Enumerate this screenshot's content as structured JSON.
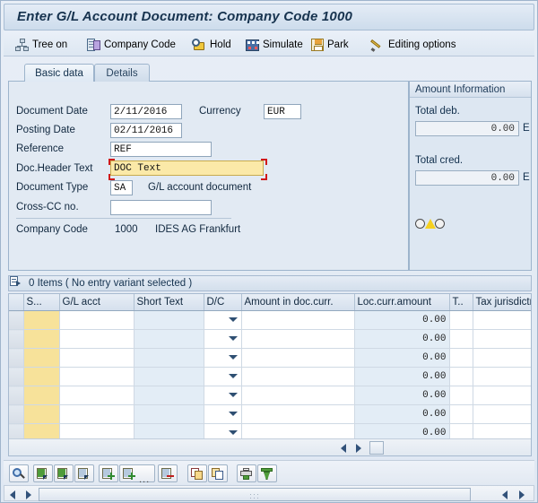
{
  "window": {
    "title": "Enter G/L Account Document: Company Code 1000"
  },
  "toolbar": {
    "items": [
      {
        "label": "Tree on",
        "icon": "tree-icon"
      },
      {
        "label": "Company Code",
        "icon": "company-code-icon"
      },
      {
        "label": "Hold",
        "icon": "hold-icon"
      },
      {
        "label": "Simulate",
        "icon": "simulate-icon"
      },
      {
        "label": "Park",
        "icon": "park-icon"
      },
      {
        "label": "Editing options",
        "icon": "pencil-icon"
      }
    ]
  },
  "tabs": [
    {
      "label": "Basic data",
      "active": true
    },
    {
      "label": "Details",
      "active": false
    }
  ],
  "basic_data": {
    "fields": [
      {
        "label": "Document Date",
        "value": "2/11/2016"
      },
      {
        "label": "Posting Date",
        "value": "02/11/2016"
      },
      {
        "label": "Reference",
        "value": "REF"
      },
      {
        "label": "Doc.Header Text",
        "value": "DOC Text"
      },
      {
        "label": "Document Type",
        "value": "SA"
      },
      {
        "label": "Cross-CC no.",
        "value": ""
      }
    ],
    "currency": {
      "label": "Currency",
      "value": "EUR"
    },
    "document_type_text": "G/L account document",
    "company_code": {
      "label": "Company Code",
      "value": "1000",
      "description": "IDES AG Frankfurt"
    }
  },
  "amount_information": {
    "header": "Amount Information",
    "total_debit": {
      "label": "Total deb.",
      "value": "0.00",
      "currency": "E"
    },
    "total_credit": {
      "label": "Total cred.",
      "value": "0.00",
      "currency": "E"
    },
    "status_indicator": "traffic-light-yellow"
  },
  "items": {
    "summary": "0 Items ( No entry variant selected )",
    "columns": [
      "S...",
      "G/L acct",
      "Short Text",
      "D/C",
      "Amount in doc.curr.",
      "Loc.curr.amount",
      "T..",
      "Tax jurisdictn code"
    ],
    "rows": [
      {
        "status": "",
        "gl_acct": "",
        "short_text": "",
        "dc": "",
        "amount_doc": "",
        "loc_amount": "0.00",
        "tax": "",
        "tax_jur": ""
      },
      {
        "status": "",
        "gl_acct": "",
        "short_text": "",
        "dc": "",
        "amount_doc": "",
        "loc_amount": "0.00",
        "tax": "",
        "tax_jur": ""
      },
      {
        "status": "",
        "gl_acct": "",
        "short_text": "",
        "dc": "",
        "amount_doc": "",
        "loc_amount": "0.00",
        "tax": "",
        "tax_jur": ""
      },
      {
        "status": "",
        "gl_acct": "",
        "short_text": "",
        "dc": "",
        "amount_doc": "",
        "loc_amount": "0.00",
        "tax": "",
        "tax_jur": ""
      },
      {
        "status": "",
        "gl_acct": "",
        "short_text": "",
        "dc": "",
        "amount_doc": "",
        "loc_amount": "0.00",
        "tax": "",
        "tax_jur": ""
      },
      {
        "status": "",
        "gl_acct": "",
        "short_text": "",
        "dc": "",
        "amount_doc": "",
        "loc_amount": "0.00",
        "tax": "",
        "tax_jur": ""
      },
      {
        "status": "",
        "gl_acct": "",
        "short_text": "",
        "dc": "",
        "amount_doc": "",
        "loc_amount": "0.00",
        "tax": "",
        "tax_jur": ""
      }
    ]
  },
  "bottom_toolbar": {
    "buttons": [
      {
        "icon": "find-icon"
      },
      {
        "icon": "select-layout-icon"
      },
      {
        "icon": "save-layout-icon"
      },
      {
        "icon": "choose-layout-icon"
      },
      {
        "icon": "insert-row-icon"
      },
      {
        "icon": "insert-row-more-icon"
      },
      {
        "icon": "delete-row-icon"
      },
      {
        "icon": "copy-icon"
      },
      {
        "icon": "paste-icon"
      },
      {
        "icon": "print-icon"
      },
      {
        "icon": "filter-icon"
      }
    ],
    "more_label": "..."
  },
  "colors": {
    "title_text": "#17334f",
    "focus_field": "#fbe9a8",
    "focus_border": "#d01919",
    "status_cell": "#f7e29a",
    "readonly_cell": "#e3edf6"
  }
}
